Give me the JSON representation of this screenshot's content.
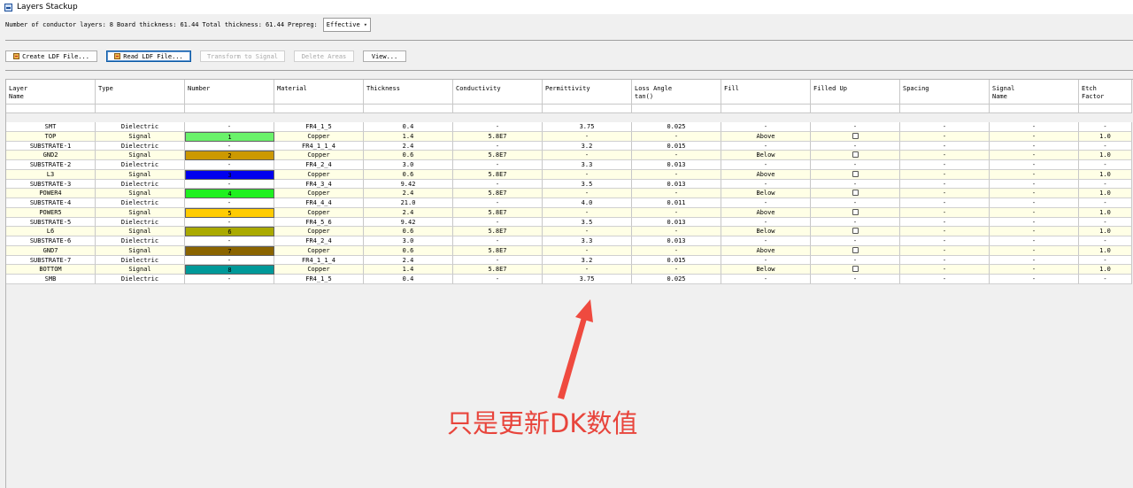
{
  "window": {
    "title": "Layers Stackup"
  },
  "info": {
    "conductor_layers_label": "Number of conductor layers:",
    "conductor_layers_value": "8",
    "board_thickness_label": "Board thickness:",
    "board_thickness_value": "61.44",
    "total_thickness_label": "Total thickness:",
    "total_thickness_value": "61.44",
    "prepreg_label": "Prepreg:",
    "prepreg_value": "Effective"
  },
  "toolbar": {
    "create_ldf": "Create LDF File...",
    "read_ldf": "Read LDF File...",
    "transform_signal": "Transform to Signal",
    "delete_areas": "Delete Areas",
    "view": "View..."
  },
  "columns": [
    {
      "key": "name",
      "label": "Layer\nName"
    },
    {
      "key": "type",
      "label": "Type"
    },
    {
      "key": "number",
      "label": "Number"
    },
    {
      "key": "material",
      "label": "Material"
    },
    {
      "key": "thickness",
      "label": "Thickness"
    },
    {
      "key": "conductivity",
      "label": "Conductivity"
    },
    {
      "key": "permittivity",
      "label": "Permittivity"
    },
    {
      "key": "loss",
      "label": "Loss Angle\ntan()"
    },
    {
      "key": "fill",
      "label": "Fill"
    },
    {
      "key": "filled_up",
      "label": "Filled Up"
    },
    {
      "key": "spacing",
      "label": "Spacing"
    },
    {
      "key": "signal_name",
      "label": "Signal\nName"
    },
    {
      "key": "etch",
      "label": "Etch\nFactor"
    }
  ],
  "rows": [
    {
      "name": "SMT",
      "type": "Dielectric",
      "number": "-",
      "color": "",
      "material": "FR4_1_5",
      "thickness": "0.4",
      "conductivity": "-",
      "permittivity": "3.75",
      "loss": "0.025",
      "fill": "-",
      "filled_up": "-",
      "spacing": "-",
      "signal_name": "-",
      "etch": "-"
    },
    {
      "name": "TOP",
      "type": "Signal",
      "number": "1",
      "color": "#6af26a",
      "material": "Copper",
      "thickness": "1.4",
      "conductivity": "5.8E7",
      "permittivity": "-",
      "loss": "-",
      "fill": "Above",
      "filled_up": "checkbox",
      "spacing": "-",
      "signal_name": "-",
      "etch": "1.0"
    },
    {
      "name": "SUBSTRATE-1",
      "type": "Dielectric",
      "number": "-",
      "color": "",
      "material": "FR4_1_1_4",
      "thickness": "2.4",
      "conductivity": "-",
      "permittivity": "3.2",
      "loss": "0.015",
      "fill": "-",
      "filled_up": "-",
      "spacing": "-",
      "signal_name": "-",
      "etch": "-"
    },
    {
      "name": "GND2",
      "type": "Signal",
      "number": "2",
      "color": "#cc9900",
      "material": "Copper",
      "thickness": "0.6",
      "conductivity": "5.8E7",
      "permittivity": "-",
      "loss": "-",
      "fill": "Below",
      "filled_up": "checkbox",
      "spacing": "-",
      "signal_name": "-",
      "etch": "1.0"
    },
    {
      "name": "SUBSTRATE-2",
      "type": "Dielectric",
      "number": "-",
      "color": "",
      "material": "FR4_2_4",
      "thickness": "3.0",
      "conductivity": "-",
      "permittivity": "3.3",
      "loss": "0.013",
      "fill": "-",
      "filled_up": "-",
      "spacing": "-",
      "signal_name": "-",
      "etch": "-"
    },
    {
      "name": "L3",
      "type": "Signal",
      "number": "3",
      "color": "#0000ee",
      "material": "Copper",
      "thickness": "0.6",
      "conductivity": "5.8E7",
      "permittivity": "-",
      "loss": "-",
      "fill": "Above",
      "filled_up": "checkbox",
      "spacing": "-",
      "signal_name": "-",
      "etch": "1.0"
    },
    {
      "name": "SUBSTRATE-3",
      "type": "Dielectric",
      "number": "-",
      "color": "",
      "material": "FR4_3_4",
      "thickness": "9.42",
      "conductivity": "-",
      "permittivity": "3.5",
      "loss": "0.013",
      "fill": "-",
      "filled_up": "-",
      "spacing": "-",
      "signal_name": "-",
      "etch": "-"
    },
    {
      "name": "POWER4",
      "type": "Signal",
      "number": "4",
      "color": "#1ff01f",
      "material": "Copper",
      "thickness": "2.4",
      "conductivity": "5.8E7",
      "permittivity": "-",
      "loss": "-",
      "fill": "Below",
      "filled_up": "checkbox",
      "spacing": "-",
      "signal_name": "-",
      "etch": "1.0"
    },
    {
      "name": "SUBSTRATE-4",
      "type": "Dielectric",
      "number": "-",
      "color": "",
      "material": "FR4_4_4",
      "thickness": "21.0",
      "conductivity": "-",
      "permittivity": "4.0",
      "loss": "0.011",
      "fill": "-",
      "filled_up": "-",
      "spacing": "-",
      "signal_name": "-",
      "etch": "-"
    },
    {
      "name": "POWER5",
      "type": "Signal",
      "number": "5",
      "color": "#ffcc00",
      "material": "Copper",
      "thickness": "2.4",
      "conductivity": "5.8E7",
      "permittivity": "-",
      "loss": "-",
      "fill": "Above",
      "filled_up": "checkbox",
      "spacing": "-",
      "signal_name": "-",
      "etch": "1.0"
    },
    {
      "name": "SUBSTRATE-5",
      "type": "Dielectric",
      "number": "-",
      "color": "",
      "material": "FR4_5_6",
      "thickness": "9.42",
      "conductivity": "-",
      "permittivity": "3.5",
      "loss": "0.013",
      "fill": "-",
      "filled_up": "-",
      "spacing": "-",
      "signal_name": "-",
      "etch": "-"
    },
    {
      "name": "L6",
      "type": "Signal",
      "number": "6",
      "color": "#aaaa00",
      "material": "Copper",
      "thickness": "0.6",
      "conductivity": "5.8E7",
      "permittivity": "-",
      "loss": "-",
      "fill": "Below",
      "filled_up": "checkbox",
      "spacing": "-",
      "signal_name": "-",
      "etch": "1.0"
    },
    {
      "name": "SUBSTRATE-6",
      "type": "Dielectric",
      "number": "-",
      "color": "",
      "material": "FR4_2_4",
      "thickness": "3.0",
      "conductivity": "-",
      "permittivity": "3.3",
      "loss": "0.013",
      "fill": "-",
      "filled_up": "-",
      "spacing": "-",
      "signal_name": "-",
      "etch": "-"
    },
    {
      "name": "GND7",
      "type": "Signal",
      "number": "7",
      "color": "#8a6400",
      "material": "Copper",
      "thickness": "0.6",
      "conductivity": "5.8E7",
      "permittivity": "-",
      "loss": "-",
      "fill": "Above",
      "filled_up": "checkbox",
      "spacing": "-",
      "signal_name": "-",
      "etch": "1.0"
    },
    {
      "name": "SUBSTRATE-7",
      "type": "Dielectric",
      "number": "-",
      "color": "",
      "material": "FR4_1_1_4",
      "thickness": "2.4",
      "conductivity": "-",
      "permittivity": "3.2",
      "loss": "0.015",
      "fill": "-",
      "filled_up": "-",
      "spacing": "-",
      "signal_name": "-",
      "etch": "-"
    },
    {
      "name": "BOTTOM",
      "type": "Signal",
      "number": "8",
      "color": "#009999",
      "material": "Copper",
      "thickness": "1.4",
      "conductivity": "5.8E7",
      "permittivity": "-",
      "loss": "-",
      "fill": "Below",
      "filled_up": "checkbox",
      "spacing": "-",
      "signal_name": "-",
      "etch": "1.0"
    },
    {
      "name": "SMB",
      "type": "Dielectric",
      "number": "-",
      "color": "",
      "material": "FR4_1_5",
      "thickness": "0.4",
      "conductivity": "-",
      "permittivity": "3.75",
      "loss": "0.025",
      "fill": "-",
      "filled_up": "-",
      "spacing": "-",
      "signal_name": "-",
      "etch": "-"
    }
  ],
  "annotation": {
    "text": "只是更新DK数值",
    "color": "#e8453c"
  }
}
